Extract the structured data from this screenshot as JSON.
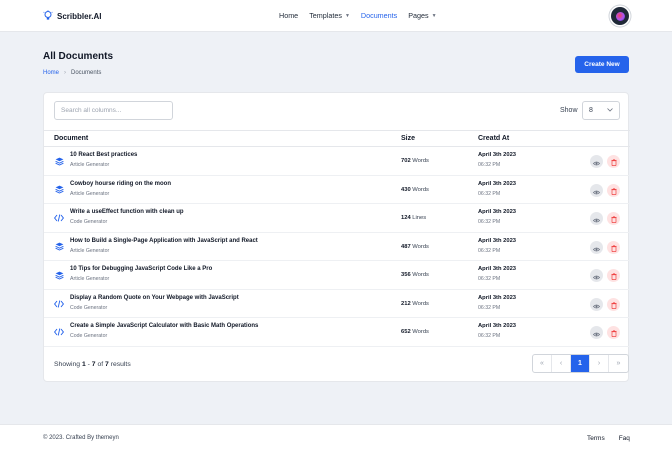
{
  "header": {
    "brand": "Scribbler.AI",
    "nav": [
      {
        "label": "Home",
        "active": false,
        "dropdown": false
      },
      {
        "label": "Templates",
        "active": false,
        "dropdown": true
      },
      {
        "label": "Documents",
        "active": true,
        "dropdown": false
      },
      {
        "label": "Pages",
        "active": false,
        "dropdown": true
      }
    ]
  },
  "page": {
    "title": "All Documents",
    "breadcrumb": {
      "home": "Home",
      "current": "Documents"
    },
    "create_button": "Create New"
  },
  "table": {
    "search_placeholder": "Search all columns...",
    "show_label": "Show",
    "show_value": "8",
    "columns": [
      "Document",
      "Size",
      "Creatd At"
    ],
    "rows": [
      {
        "icon": "article-icon",
        "title": "10 React Best practices",
        "type": "Article Generator",
        "size_value": "702",
        "size_unit": "Words",
        "date": "April 3th 2023",
        "time": "06:32 PM"
      },
      {
        "icon": "article-icon",
        "title": "Cowboy hourse riding on the moon",
        "type": "Article Generator",
        "size_value": "430",
        "size_unit": "Words",
        "date": "April 3th 2023",
        "time": "06:32 PM"
      },
      {
        "icon": "code-icon",
        "title": "Write a useEffect function with clean up",
        "type": "Code Generator",
        "size_value": "124",
        "size_unit": "Lines",
        "date": "April 3th 2023",
        "time": "06:32 PM"
      },
      {
        "icon": "article-icon",
        "title": "How to Build a Single-Page Application with JavaScript and React",
        "type": "Article Generator",
        "size_value": "487",
        "size_unit": "Words",
        "date": "April 3th 2023",
        "time": "06:32 PM"
      },
      {
        "icon": "article-icon",
        "title": "10 Tips for Debugging JavaScript Code Like a Pro",
        "type": "Article Generator",
        "size_value": "356",
        "size_unit": "Words",
        "date": "April 3th 2023",
        "time": "06:32 PM"
      },
      {
        "icon": "code-icon",
        "title": "Display a Random Quote on Your Webpage with JavaScript",
        "type": "Code Generator",
        "size_value": "212",
        "size_unit": "Words",
        "date": "April 3th 2023",
        "time": "06:32 PM"
      },
      {
        "icon": "code-icon",
        "title": "Create a Simple JavaScript Calculator with Basic Math Operations",
        "type": "Code Generator",
        "size_value": "652",
        "size_unit": "Words",
        "date": "April 3th 2023",
        "time": "06:32 PM"
      }
    ],
    "showing": {
      "prefix": "Showing",
      "from": "1",
      "dash": "-",
      "to": "7",
      "of": "of",
      "total": "7",
      "suffix": "results"
    },
    "pagination": {
      "first": "«",
      "prev": "‹",
      "current": "1",
      "next": "›",
      "last": "»"
    }
  },
  "footer": {
    "copyright": "© 2023. Crafted By themeyn",
    "links": [
      "Terms",
      "Faq"
    ]
  },
  "colors": {
    "accent": "#2563eb",
    "danger": "#ef4444"
  }
}
